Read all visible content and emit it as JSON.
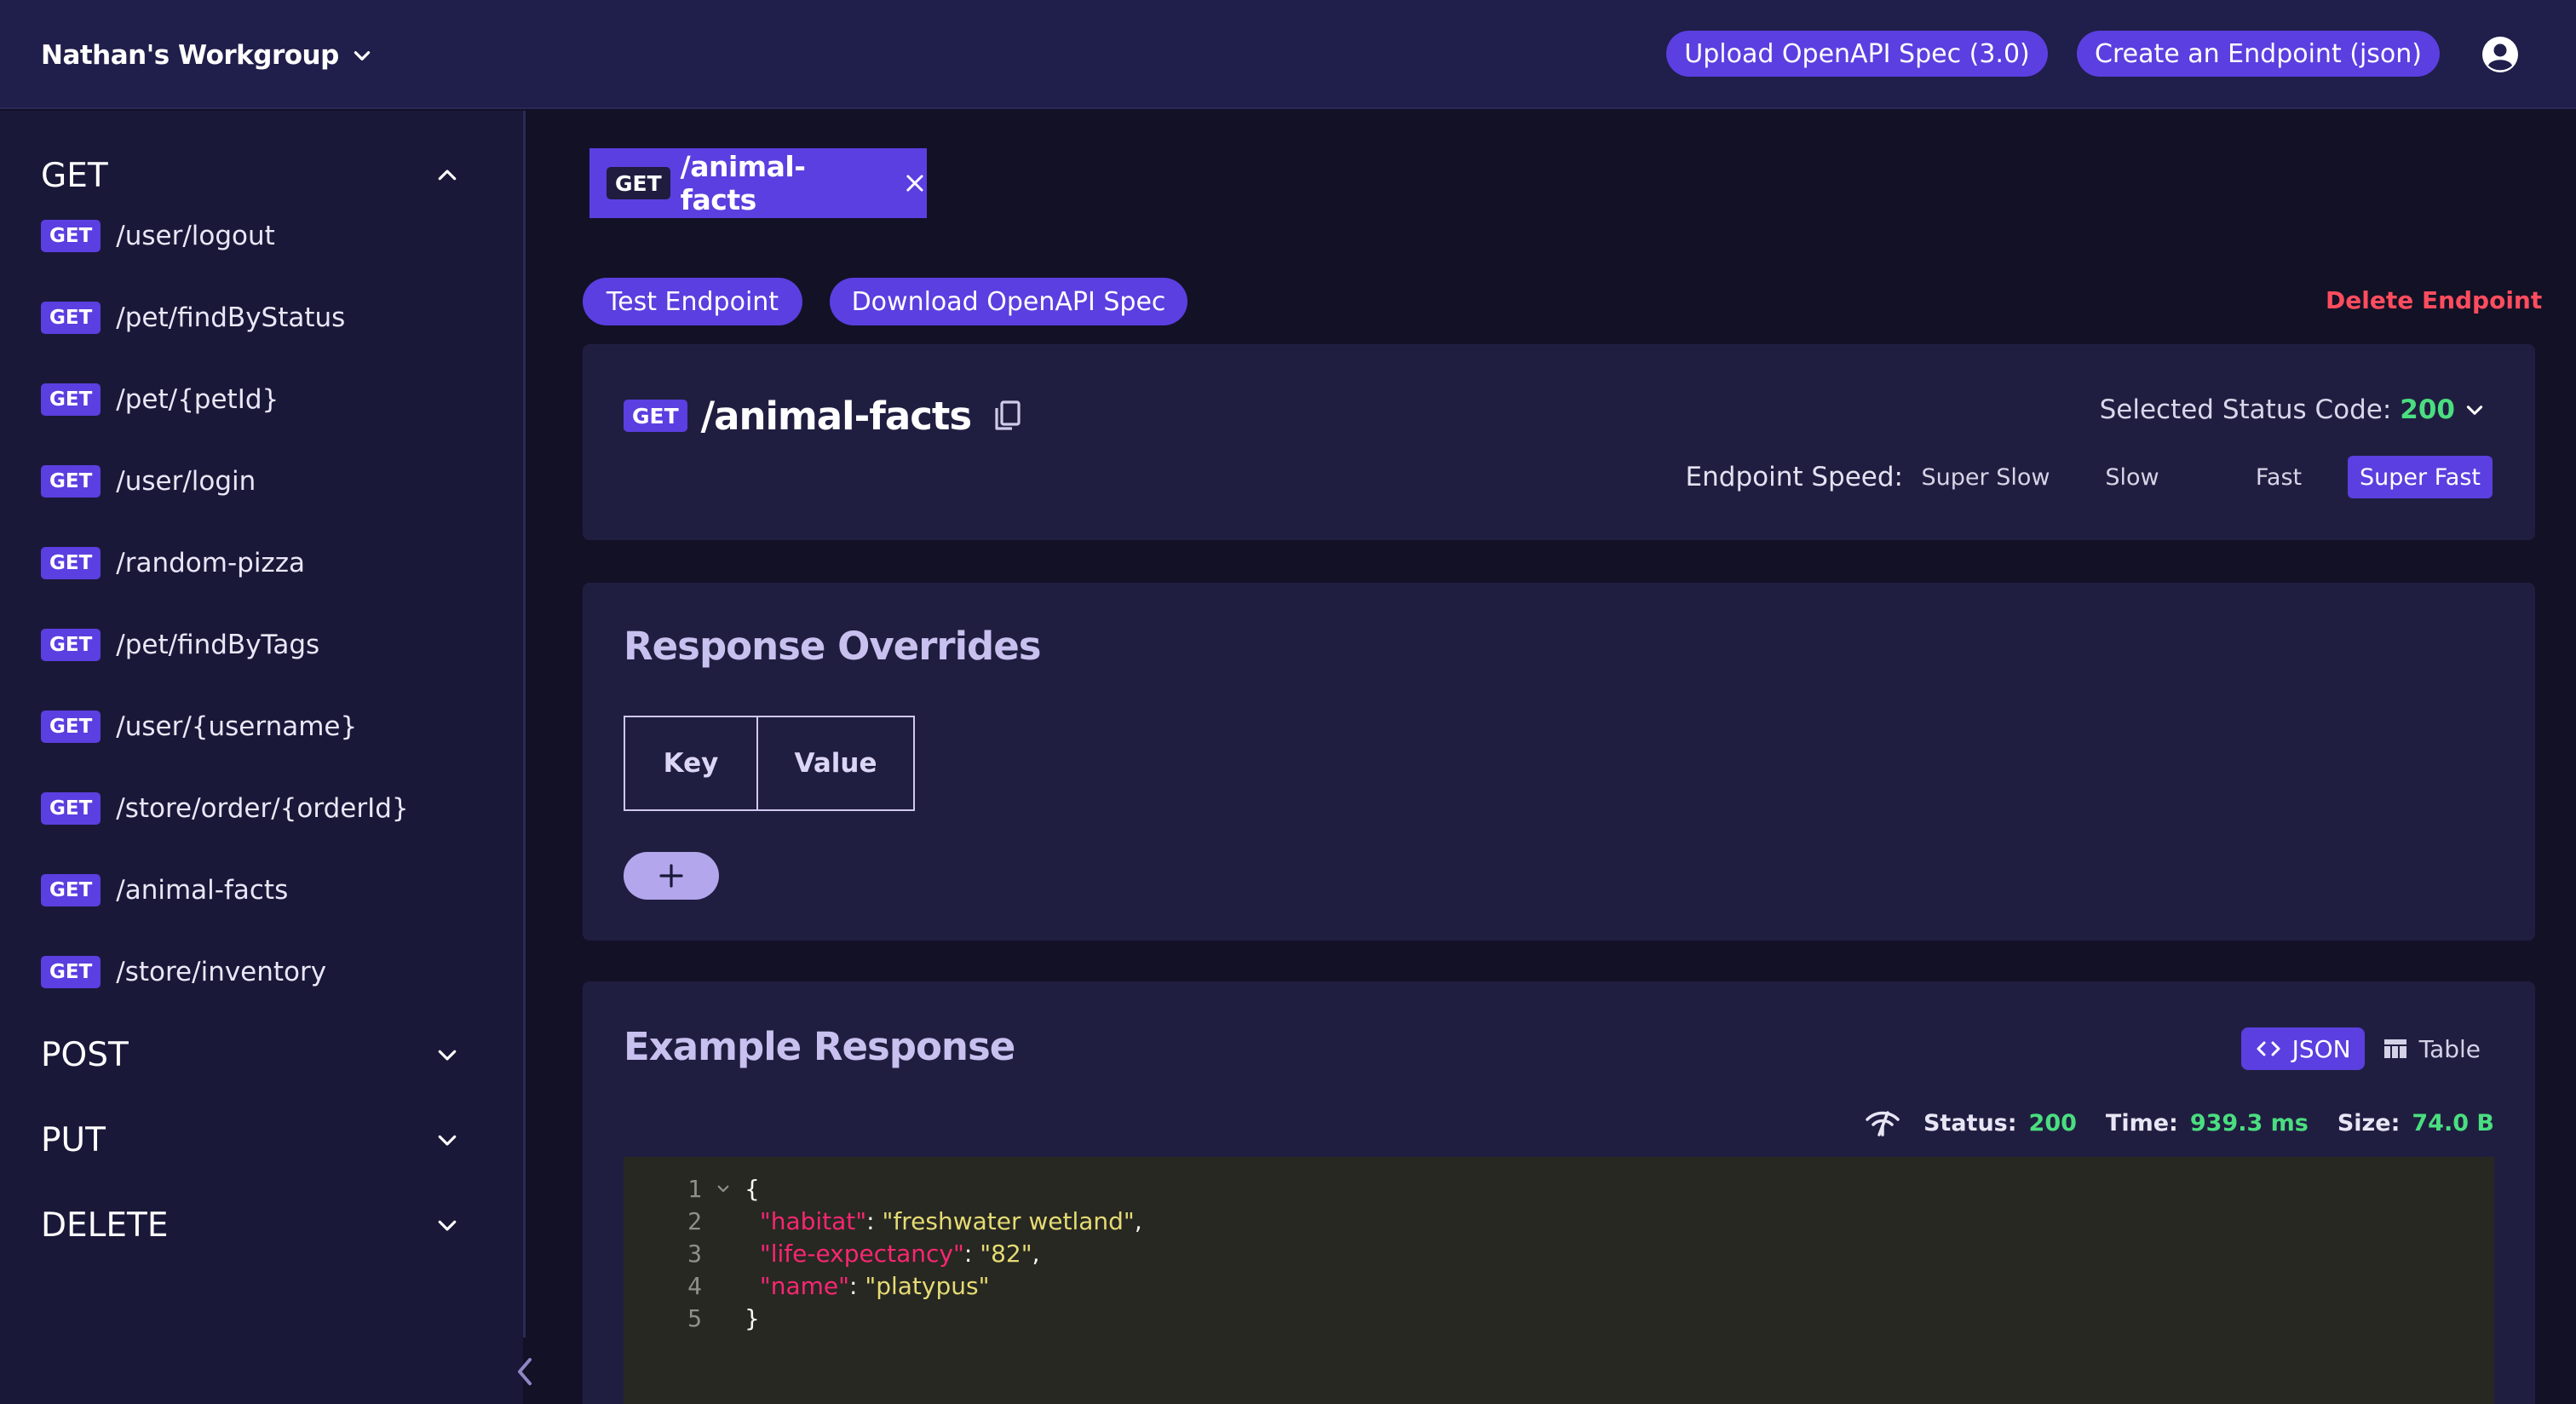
{
  "header": {
    "workgroup_name": "Nathan's Workgroup",
    "upload_label": "Upload OpenAPI Spec (3.0)",
    "create_label": "Create an Endpoint (json)"
  },
  "sidebar": {
    "sections": {
      "get": "GET",
      "post": "POST",
      "put": "PUT",
      "delete": "DELETE"
    },
    "method_badge": "GET",
    "get_items": [
      "/user/logout",
      "/pet/findByStatus",
      "/pet/{petId}",
      "/user/login",
      "/random-pizza",
      "/pet/findByTags",
      "/user/{username}",
      "/store/order/{orderId}",
      "/animal-facts",
      "/store/inventory"
    ]
  },
  "tab": {
    "method": "GET",
    "path": "/animal-facts"
  },
  "actions": {
    "test_label": "Test Endpoint",
    "download_label": "Download OpenAPI Spec",
    "delete_label": "Delete Endpoint"
  },
  "endpoint": {
    "method": "GET",
    "path": "/animal-facts",
    "status_label": "Selected Status Code:",
    "status_code": "200",
    "speed_label": "Endpoint Speed:",
    "speed_options": [
      "Super Slow",
      "Slow",
      "Fast",
      "Super Fast"
    ],
    "speed_selected": "Super Fast"
  },
  "overrides": {
    "title": "Response Overrides",
    "key_header": "Key",
    "value_header": "Value"
  },
  "example": {
    "title": "Example Response",
    "view_json": "JSON",
    "view_table": "Table",
    "status_label": "Status:",
    "status_value": "200",
    "time_label": "Time:",
    "time_value": "939.3 ms",
    "size_label": "Size:",
    "size_value": "74.0 B",
    "code_lines": [
      {
        "n": "1",
        "open": "{"
      },
      {
        "n": "2",
        "key": "\"habitat\"",
        "value": "\"freshwater wetland\"",
        "tail": ","
      },
      {
        "n": "3",
        "key": "\"life-expectancy\"",
        "value": "\"82\"",
        "tail": ","
      },
      {
        "n": "4",
        "key": "\"name\"",
        "value": "\"platypus\"",
        "tail": ""
      },
      {
        "n": "5",
        "close": "}"
      }
    ]
  },
  "colors": {
    "accent": "#5b3fe0",
    "header_bg": "#201e4a",
    "sidebar_bg": "#1a1838",
    "success": "#4ade80",
    "danger": "#ff4d5e",
    "code_bg": "#272822",
    "code_key": "#f92672",
    "code_string": "#e6db74"
  }
}
